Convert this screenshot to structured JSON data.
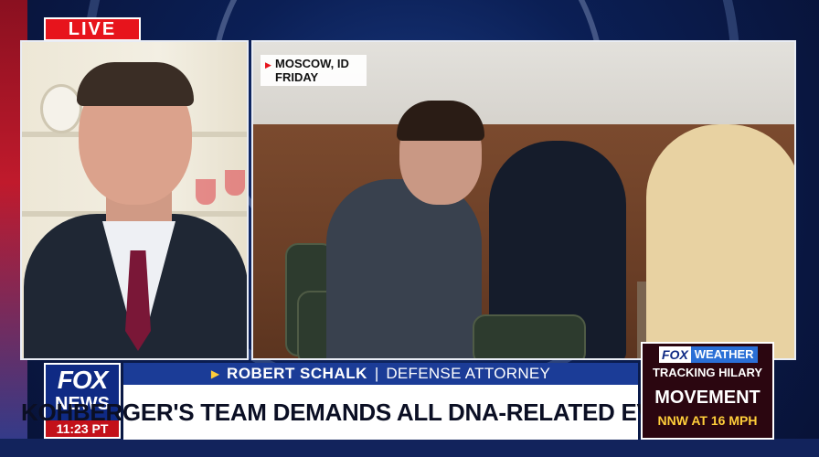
{
  "live_badge": "LIVE",
  "location_tag": {
    "line1": "MOSCOW, ID",
    "line2": "FRIDAY"
  },
  "network_logo": {
    "word1": "FOX",
    "word2": "NEWS",
    "time": "11:23 PT"
  },
  "lower_third": {
    "name": "ROBERT SCHALK",
    "separator": "|",
    "title": "DEFENSE ATTORNEY",
    "headline": "KOHBERGER'S TEAM DEMANDS ALL DNA-RELATED EVIDENCE"
  },
  "weather_box": {
    "logo_fox": "FOX",
    "logo_weather": "WEATHER",
    "line1": "TRACKING HILARY",
    "line2": "MOVEMENT",
    "line3": "NNW AT 16 MPH"
  },
  "colors": {
    "live_red": "#e7141c",
    "fox_blue": "#0f2a84",
    "name_bar_blue": "#1b3c97",
    "accent_yellow": "#ffce3a",
    "weather_bg": "#2b0610"
  }
}
